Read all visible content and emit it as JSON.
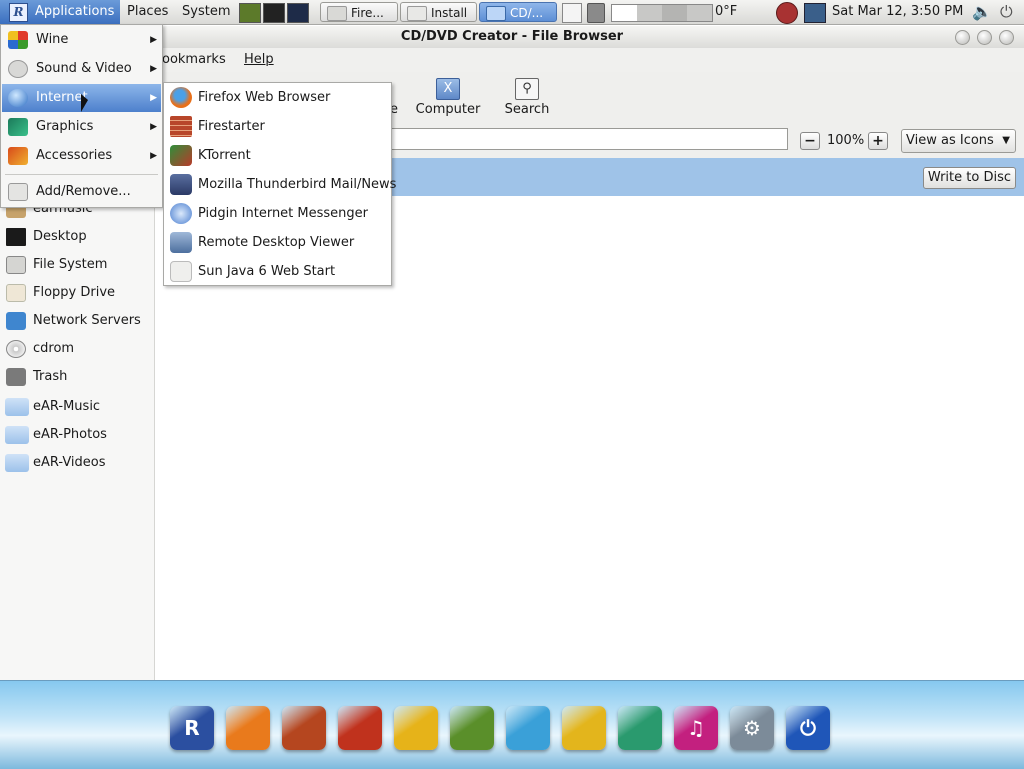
{
  "panel": {
    "applications": "Applications",
    "places": "Places",
    "system": "System",
    "tasks": [
      {
        "label": "Fire...",
        "active": false
      },
      {
        "label": "Install",
        "active": false
      },
      {
        "label": "CD/...",
        "active": true
      }
    ],
    "temperature": "0°F",
    "datetime": "Sat Mar 12,  3:50 PM"
  },
  "window": {
    "title": "CD/DVD Creator - File Browser",
    "menus": [
      "ookmarks",
      "Help"
    ],
    "toolbar": [
      {
        "label": "e",
        "icon": "home-icon"
      },
      {
        "label": "Computer",
        "icon": "computer-icon"
      },
      {
        "label": "Search",
        "icon": "search-icon"
      }
    ],
    "zoom": "100%",
    "view_mode": "View as Icons",
    "write_button": "Write to Disc"
  },
  "places": [
    {
      "label": "earmusic",
      "icon": "home-folder-icon"
    },
    {
      "label": "Desktop",
      "icon": "desktop-icon"
    },
    {
      "label": "File System",
      "icon": "filesystem-icon"
    },
    {
      "label": "Floppy Drive",
      "icon": "floppy-icon"
    },
    {
      "label": "Network Servers",
      "icon": "network-icon"
    },
    {
      "label": "cdrom",
      "icon": "cdrom-icon"
    },
    {
      "label": "Trash",
      "icon": "trash-icon"
    },
    {
      "label": "eAR-Music",
      "icon": "folder-icon"
    },
    {
      "label": "eAR-Photos",
      "icon": "folder-icon"
    },
    {
      "label": "eAR-Videos",
      "icon": "folder-icon"
    }
  ],
  "app_menu": [
    {
      "label": "Wine",
      "icon": "wine-icon",
      "submenu": true
    },
    {
      "label": "Sound & Video",
      "icon": "sound-video-icon",
      "submenu": true
    },
    {
      "label": "Internet",
      "icon": "internet-icon",
      "submenu": true
    },
    {
      "label": "Graphics",
      "icon": "graphics-icon",
      "submenu": true
    },
    {
      "label": "Accessories",
      "icon": "accessories-icon",
      "submenu": true
    },
    {
      "label": "Add/Remove...",
      "icon": "add-remove-icon",
      "submenu": false
    }
  ],
  "internet_submenu": [
    {
      "label": "Firefox Web Browser",
      "icon": "firefox-icon"
    },
    {
      "label": "Firestarter",
      "icon": "firestarter-icon"
    },
    {
      "label": "KTorrent",
      "icon": "ktorrent-icon"
    },
    {
      "label": "Mozilla Thunderbird Mail/News",
      "icon": "thunderbird-icon"
    },
    {
      "label": "Pidgin Internet Messenger",
      "icon": "pidgin-icon"
    },
    {
      "label": "Remote Desktop Viewer",
      "icon": "remote-desktop-icon"
    },
    {
      "label": "Sun Java 6 Web Start",
      "icon": "java-icon"
    }
  ],
  "dock": [
    {
      "icon": "r-logo-icon",
      "color": "#2b4fa0"
    },
    {
      "icon": "firefox-icon",
      "color": "#e97a1c"
    },
    {
      "icon": "guitar-icon",
      "color": "#b5461f"
    },
    {
      "icon": "media-player-icon",
      "color": "#c0321d"
    },
    {
      "icon": "java-cup-icon",
      "color": "#e6b319"
    },
    {
      "icon": "image-viewer-icon",
      "color": "#5a8f2a"
    },
    {
      "icon": "messenger-icon",
      "color": "#3aa0d8"
    },
    {
      "icon": "office-icon",
      "color": "#e3b51c"
    },
    {
      "icon": "paint-icon",
      "color": "#2a9a6e"
    },
    {
      "icon": "music-icon",
      "color": "#c3207f"
    },
    {
      "icon": "settings-icon",
      "color": "#7c8b99"
    },
    {
      "icon": "power-icon",
      "color": "#1f56b8"
    }
  ]
}
